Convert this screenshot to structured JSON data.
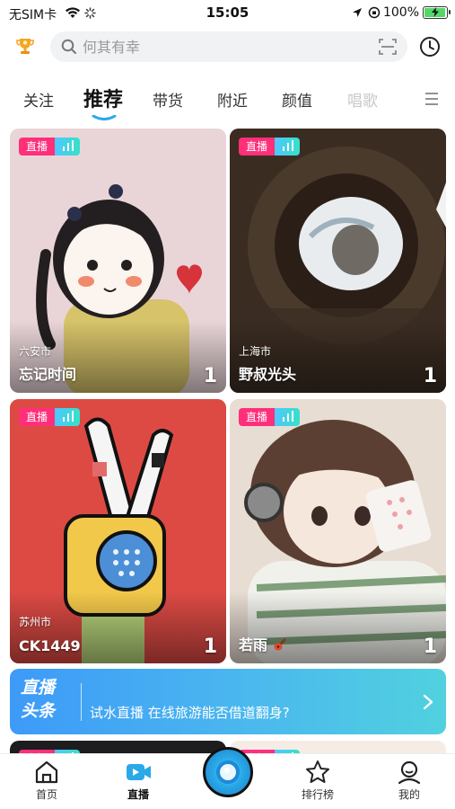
{
  "status_bar": {
    "carrier": "无SIM卡",
    "time": "15:05",
    "battery_percent": "100%",
    "battery_level": 1.0
  },
  "search": {
    "placeholder": "何其有幸"
  },
  "tabs": [
    {
      "label": "关注"
    },
    {
      "label": "推荐"
    },
    {
      "label": "带货"
    },
    {
      "label": "附近"
    },
    {
      "label": "颜值"
    },
    {
      "label": "唱歌"
    }
  ],
  "live_badge": "直播",
  "cards": [
    {
      "city": "六安市",
      "name": "忘记时间",
      "count": "1"
    },
    {
      "city": "上海市",
      "name": "野叔光头",
      "count": "1"
    },
    {
      "city": "苏州市",
      "name": "CK1449",
      "count": "1"
    },
    {
      "city": "",
      "name": "若雨",
      "count": "1"
    }
  ],
  "banner": {
    "logo_line1": "直播",
    "logo_line2": "头条",
    "headline": "试水直播 在线旅游能否借道翻身?"
  },
  "bottom_nav": [
    {
      "label": "首页"
    },
    {
      "label": "直播"
    },
    {
      "label": "排行榜"
    },
    {
      "label": "我的"
    }
  ],
  "colors": {
    "live_badge": "#ff2f7a",
    "accent": "#29a9e8",
    "banner_start": "#3d9af8",
    "banner_end": "#51d1df"
  }
}
